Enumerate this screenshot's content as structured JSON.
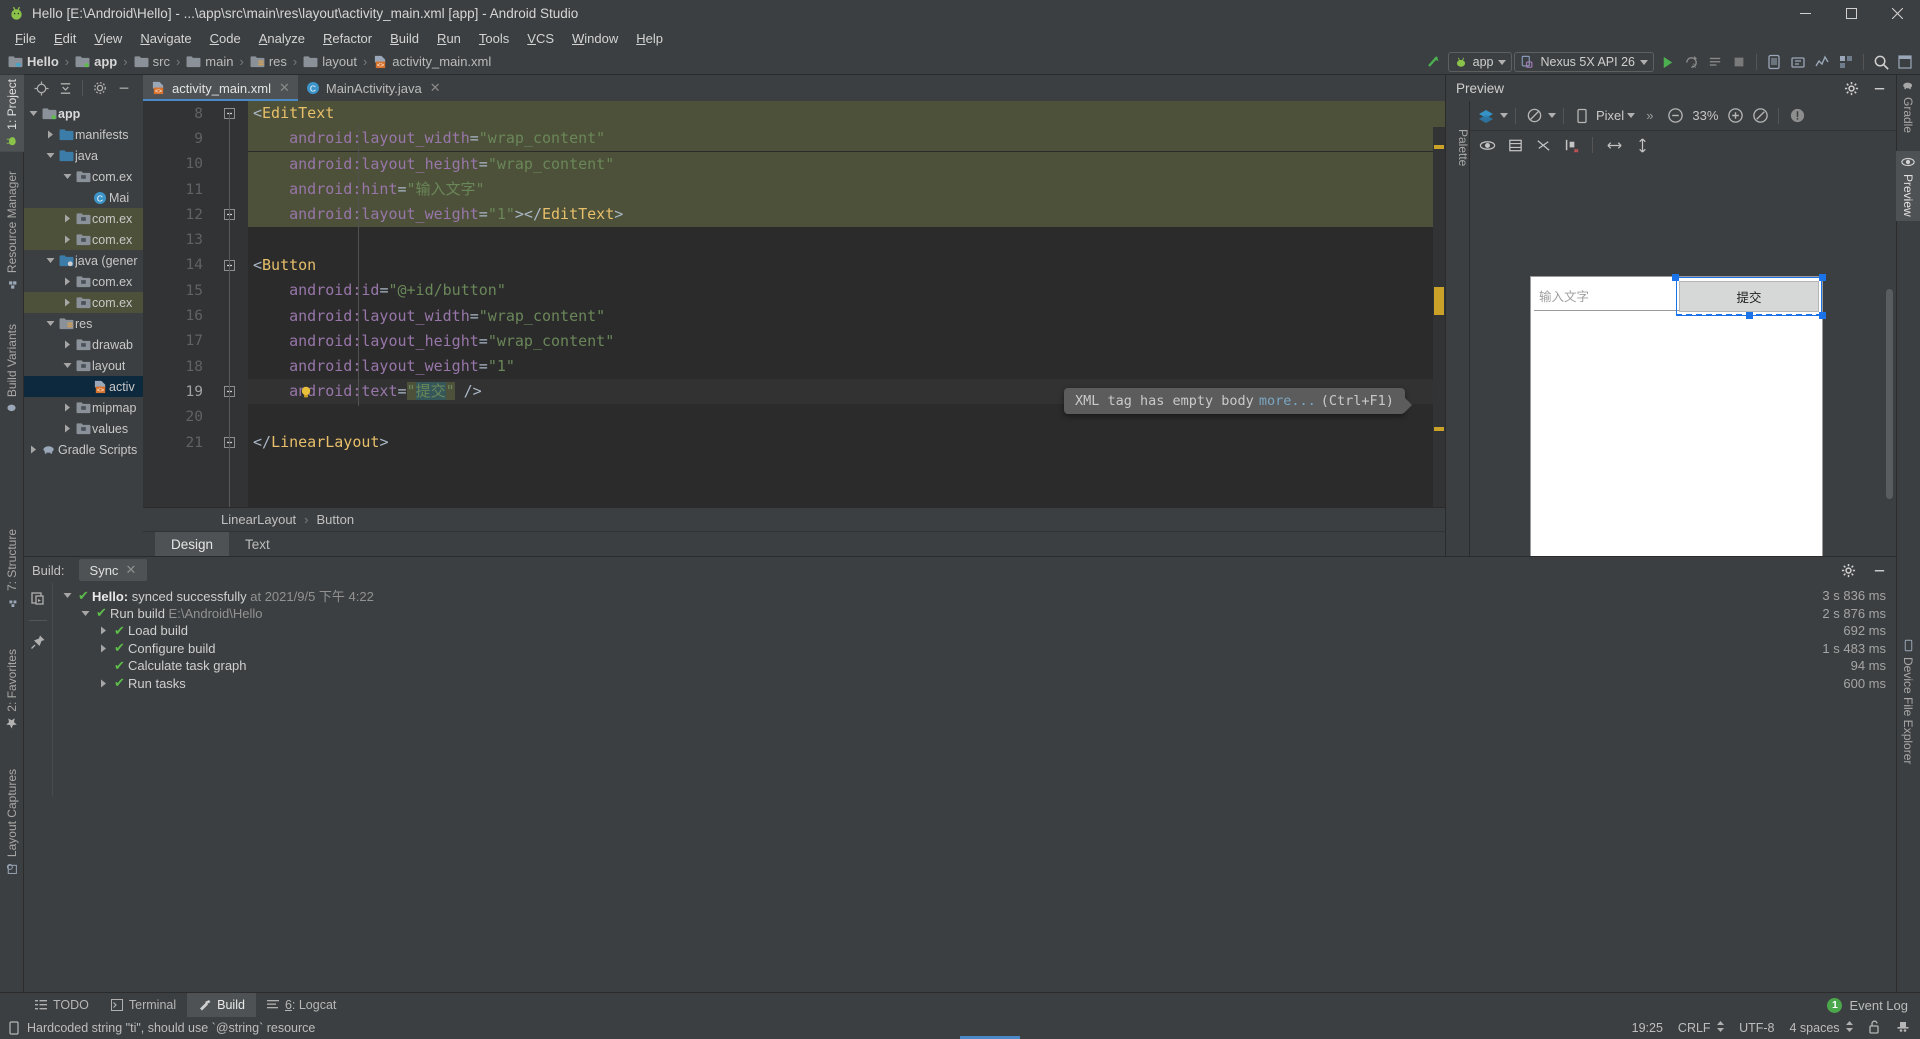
{
  "window": {
    "title": "Hello [E:\\Android\\Hello] - ...\\app\\src\\main\\res\\layout\\activity_main.xml [app] - Android Studio",
    "minimize": "minimize-icon",
    "maximize": "maximize-icon",
    "close": "close-icon"
  },
  "menu": [
    "File",
    "Edit",
    "View",
    "Navigate",
    "Code",
    "Analyze",
    "Refactor",
    "Build",
    "Run",
    "Tools",
    "VCS",
    "Window",
    "Help"
  ],
  "breadcrumbs": [
    {
      "label": "Hello",
      "icon": "module-icon",
      "bold": true
    },
    {
      "label": "app",
      "icon": "module-green-icon",
      "bold": true
    },
    {
      "label": "src",
      "icon": "folder-icon",
      "bold": false
    },
    {
      "label": "main",
      "icon": "folder-icon",
      "bold": false
    },
    {
      "label": "res",
      "icon": "res-folder-icon",
      "bold": false
    },
    {
      "label": "layout",
      "icon": "folder-icon",
      "bold": false
    },
    {
      "label": "activity_main.xml",
      "icon": "xml-layout-icon",
      "bold": false
    }
  ],
  "toolbar": {
    "run_config": "app",
    "device": "Nexus 5X API 26",
    "run_icon": "run-icon",
    "debug_icon": "debug-icon",
    "sync_icon": "sync-gradle-icon",
    "avd_icon": "avd-manager-icon",
    "sdk_icon": "sdk-manager-icon",
    "search_icon": "search-icon"
  },
  "left_tool_tabs": [
    {
      "label": "1: Project",
      "icon": "project-icon",
      "selected": true
    },
    {
      "label": "Resource Manager",
      "icon": "resource-manager-icon",
      "selected": false
    },
    {
      "label": "Build Variants",
      "icon": "build-variants-icon",
      "selected": false
    },
    {
      "label": "7: Structure",
      "icon": "structure-icon",
      "selected": false
    },
    {
      "label": "2: Favorites",
      "icon": "favorites-star-icon",
      "selected": false
    },
    {
      "label": "Layout Captures",
      "icon": "layout-captures-icon",
      "selected": false
    }
  ],
  "right_tool_tabs": [
    {
      "label": "Gradle",
      "icon": "gradle-elephant-icon",
      "selected": false
    },
    {
      "label": "Preview",
      "icon": "eye-icon",
      "selected": true
    },
    {
      "label": "Device File Explorer",
      "icon": "device-file-icon",
      "selected": false
    }
  ],
  "project": {
    "toolbar_icons": [
      "locate-icon",
      "collapse-all-icon",
      "settings-gear-icon",
      "hide-icon"
    ],
    "tree": [
      {
        "label": "app",
        "depth": 0,
        "arrow": "down",
        "icon": "module-green-icon",
        "bold": true,
        "state": "normal"
      },
      {
        "label": "manifests",
        "depth": 1,
        "arrow": "right",
        "icon": "folder-blue-icon",
        "bold": false,
        "state": "normal"
      },
      {
        "label": "java",
        "depth": 1,
        "arrow": "down",
        "icon": "folder-blue-icon",
        "bold": false,
        "state": "normal"
      },
      {
        "label": "com.ex",
        "depth": 2,
        "arrow": "down",
        "icon": "package-icon",
        "bold": false,
        "state": "normal"
      },
      {
        "label": "Mai",
        "depth": 3,
        "arrow": "none",
        "icon": "java-class-icon",
        "bold": false,
        "state": "normal"
      },
      {
        "label": "com.ex",
        "depth": 2,
        "arrow": "right",
        "icon": "package-icon",
        "bold": false,
        "state": "hl"
      },
      {
        "label": "com.ex",
        "depth": 2,
        "arrow": "right",
        "icon": "package-icon",
        "bold": false,
        "state": "hl"
      },
      {
        "label": "java (gener",
        "depth": 1,
        "arrow": "down",
        "icon": "folder-generated-icon",
        "bold": false,
        "state": "normal"
      },
      {
        "label": "com.ex",
        "depth": 2,
        "arrow": "right",
        "icon": "package-icon",
        "bold": false,
        "state": "normal"
      },
      {
        "label": "com.ex",
        "depth": 2,
        "arrow": "right",
        "icon": "package-icon",
        "bold": false,
        "state": "hl"
      },
      {
        "label": "res",
        "depth": 1,
        "arrow": "down",
        "icon": "res-folder-icon",
        "bold": false,
        "state": "normal"
      },
      {
        "label": "drawab",
        "depth": 2,
        "arrow": "right",
        "icon": "package-icon",
        "bold": false,
        "state": "normal"
      },
      {
        "label": "layout",
        "depth": 2,
        "arrow": "down",
        "icon": "package-icon",
        "bold": false,
        "state": "normal"
      },
      {
        "label": "activ",
        "depth": 3,
        "arrow": "none",
        "icon": "xml-layout-icon",
        "bold": false,
        "state": "sel"
      },
      {
        "label": "mipmap",
        "depth": 2,
        "arrow": "right",
        "icon": "package-icon",
        "bold": false,
        "state": "normal"
      },
      {
        "label": "values",
        "depth": 2,
        "arrow": "right",
        "icon": "package-icon",
        "bold": false,
        "state": "normal"
      },
      {
        "label": "Gradle Scripts",
        "depth": 0,
        "arrow": "right",
        "icon": "gradle-elephant-icon",
        "bold": false,
        "state": "normal"
      }
    ]
  },
  "editor": {
    "tabs": [
      {
        "label": "activity_main.xml",
        "icon": "xml-layout-icon",
        "active": true
      },
      {
        "label": "MainActivity.java",
        "icon": "java-class-icon",
        "active": false
      }
    ],
    "lines": [
      {
        "num": "8",
        "highlight": true,
        "current": false,
        "bulb": false,
        "fold": "open",
        "html": "<span class='tok-punct'>&lt;</span><span class='tok-tag'>EditText</span>",
        "indent": 0
      },
      {
        "num": "9",
        "highlight": true,
        "current": false,
        "bulb": false,
        "fold": "none",
        "html": "    <span class='tok-attr'>android:layout_width</span><span class='tok-punct'>=</span><span class='tok-val'>\"wrap_content\"</span>",
        "indent": 0
      },
      {
        "num": "10",
        "highlight": true,
        "current": false,
        "bulb": false,
        "fold": "none",
        "html": "    <span class='tok-attr'>android:layout_height</span><span class='tok-punct'>=</span><span class='tok-val'>\"wrap_content\"</span>",
        "indent": 0
      },
      {
        "num": "11",
        "highlight": true,
        "current": false,
        "bulb": false,
        "fold": "none",
        "html": "    <span class='tok-attr'>android:hint</span><span class='tok-punct'>=</span><span class='tok-val'>\"输入文字\"</span>",
        "indent": 0
      },
      {
        "num": "12",
        "highlight": true,
        "current": false,
        "bulb": false,
        "fold": "close",
        "html": "    <span class='tok-attr'>android:layout_weight</span><span class='tok-punct'>=</span><span class='tok-val'>\"1\"</span><span class='tok-punct'>&gt;&lt;/</span><span class='tok-tag'>EditText</span><span class='tok-punct'>&gt;</span>",
        "indent": 0
      },
      {
        "num": "13",
        "highlight": false,
        "current": false,
        "bulb": false,
        "fold": "none",
        "html": "",
        "indent": 0
      },
      {
        "num": "14",
        "highlight": false,
        "current": false,
        "bulb": false,
        "fold": "open",
        "html": "<span class='tok-punct'>&lt;</span><span class='tok-tag'>Button</span>",
        "indent": 0
      },
      {
        "num": "15",
        "highlight": false,
        "current": false,
        "bulb": false,
        "fold": "none",
        "html": "    <span class='tok-attr'>android:id</span><span class='tok-punct'>=</span><span class='tok-val'>\"@+id/button\"</span>",
        "indent": 0
      },
      {
        "num": "16",
        "highlight": false,
        "current": false,
        "bulb": false,
        "fold": "none",
        "html": "    <span class='tok-attr'>android:layout_width</span><span class='tok-punct'>=</span><span class='tok-val'>\"wrap_content\"</span>",
        "indent": 0
      },
      {
        "num": "17",
        "highlight": false,
        "current": false,
        "bulb": false,
        "fold": "none",
        "html": "    <span class='tok-attr'>android:layout_height</span><span class='tok-punct'>=</span><span class='tok-val'>\"wrap_content\"</span>",
        "indent": 0
      },
      {
        "num": "18",
        "highlight": false,
        "current": false,
        "bulb": false,
        "fold": "none",
        "html": "    <span class='tok-attr'>android:layout_weight</span><span class='tok-punct'>=</span><span class='tok-val'>\"1\"</span>",
        "indent": 0
      },
      {
        "num": "19",
        "highlight": false,
        "current": true,
        "bulb": true,
        "fold": "close",
        "html": "    <span class='tok-attr'>android:text</span><span class='tok-punct'>=</span><span class='tok-val' style='background:#4d5139'>\"</span><span style='background:#35575a;color:#6a8759'>提交</span><span class='tok-val' style='background:#4d5139'>\"</span> <span class='tok-punct'>/&gt;</span>",
        "indent": 0
      },
      {
        "num": "20",
        "highlight": false,
        "current": false,
        "bulb": false,
        "fold": "none",
        "html": "",
        "indent": 0
      },
      {
        "num": "21",
        "highlight": false,
        "current": false,
        "bulb": false,
        "fold": "close",
        "html": "<span class='tok-punct'>&lt;/</span><span class='tok-tag'>LinearLayout</span><span class='tok-punct'>&gt;</span>",
        "indent": 0
      }
    ],
    "tooltip": {
      "text": "XML tag has empty body",
      "more": "more...",
      "shortcut": "(Ctrl+F1)"
    },
    "component_path": [
      "LinearLayout",
      "Button"
    ],
    "design_tabs": [
      {
        "label": "Design",
        "active": true
      },
      {
        "label": "Text",
        "active": false
      }
    ]
  },
  "preview": {
    "title": "Preview",
    "palette_label": "Palette",
    "gear_icon": "settings-gear-icon",
    "minimize_icon": "minimize-icon",
    "toolbar": {
      "layers_icon": "design-mode-icon",
      "orientation_icon": "orientation-icon",
      "device_icon": "device-icon",
      "device_label": "Pixel",
      "overflow": "»",
      "zoom_out_icon": "zoom-out-icon",
      "zoom_level": "33%",
      "zoom_in_icon": "zoom-in-icon",
      "zoom_fit_icon": "zoom-fit-icon",
      "issues_icon": "issues-icon"
    },
    "toolbar2": [
      "eye-icon",
      "blueprint-icon",
      "no-constraints-icon",
      "margins-icon",
      "horizontal-align-icon",
      "vertical-align-icon"
    ],
    "device_render": {
      "edittext_hint": "输入文字",
      "button_text": "提交"
    }
  },
  "build": {
    "header_label": "Build:",
    "tab_label": "Sync",
    "tab_close": "close-icon",
    "nodes": [
      {
        "depth": 0,
        "arrow": "down",
        "prefix": "Hello:",
        "text": " synced successfully",
        "dim": " at 2021/9/5 下午 4:22",
        "time": "3 s 836 ms"
      },
      {
        "depth": 1,
        "arrow": "down",
        "prefix": "",
        "text": "Run build",
        "dim": " E:\\Android\\Hello",
        "time": "2 s 876 ms"
      },
      {
        "depth": 2,
        "arrow": "right",
        "prefix": "",
        "text": "Load build",
        "dim": "",
        "time": "692 ms"
      },
      {
        "depth": 2,
        "arrow": "right",
        "prefix": "",
        "text": "Configure build",
        "dim": "",
        "time": "1 s 483 ms"
      },
      {
        "depth": 2,
        "arrow": "none",
        "prefix": "",
        "text": "Calculate task graph",
        "dim": "",
        "time": "94 ms"
      },
      {
        "depth": 2,
        "arrow": "right",
        "prefix": "",
        "text": "Run tasks",
        "dim": "",
        "time": "600 ms"
      }
    ],
    "side_icons": [
      "rerun-icon",
      "pin-icon"
    ],
    "act_icons": [
      "settings-gear-icon",
      "minimize-icon"
    ]
  },
  "bottom_tabs": [
    {
      "label": "TODO",
      "icon": "todo-icon",
      "active": false
    },
    {
      "label": "Terminal",
      "icon": "terminal-icon",
      "active": false
    },
    {
      "label": "Build",
      "icon": "build-hammer-icon",
      "active": true
    },
    {
      "label": "6: Logcat",
      "icon": "logcat-icon",
      "active": false
    }
  ],
  "event_log": {
    "count": "1",
    "label": "Event Log"
  },
  "statusbar": {
    "icon": "device-icon",
    "message": "Hardcoded string \"ti\", should use `@string` resource",
    "caret": "19:25",
    "line_sep": "CRLF",
    "encoding": "UTF-8",
    "indent": "4 spaces",
    "lock_icon": "unlocked-icon",
    "inspector_icon": "inspector-hat-icon"
  },
  "colors": {
    "bg": "#3c3f41",
    "editor_bg": "#2b2b2b",
    "accent_blue": "#4a88c7",
    "highlight_yellow": "#4d5139",
    "selection_blue": "#0d293e",
    "green_check": "#5cbd4a",
    "tag_orange": "#e8bf6a",
    "attr_purple": "#9876aa",
    "value_green": "#6a8759"
  }
}
